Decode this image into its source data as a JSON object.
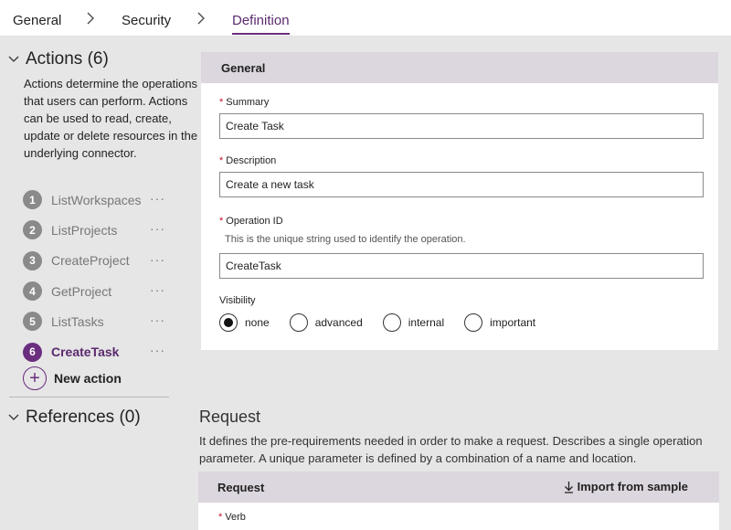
{
  "breadcrumb": [
    {
      "label": "General"
    },
    {
      "label": "Security"
    },
    {
      "label": "Definition"
    }
  ],
  "sidebar": {
    "actions_title": "Actions (6)",
    "actions_description": "Actions determine the operations that users can perform. Actions can be used to read, create, update or delete resources in the underlying connector.",
    "actions": [
      {
        "number": "1",
        "label": "ListWorkspaces",
        "more": "···"
      },
      {
        "number": "2",
        "label": "ListProjects",
        "more": "···"
      },
      {
        "number": "3",
        "label": "CreateProject",
        "more": "···"
      },
      {
        "number": "4",
        "label": "GetProject",
        "more": "···"
      },
      {
        "number": "5",
        "label": "ListTasks",
        "more": "···"
      },
      {
        "number": "6",
        "label": "CreateTask",
        "more": "···",
        "active": true
      }
    ],
    "new_action_label": "New action",
    "references_title": "References (0)"
  },
  "general": {
    "header": "General",
    "summary_label": "Summary",
    "summary_value": "Create Task",
    "description_label": "Description",
    "description_value": "Create a new task",
    "operation_id_label": "Operation ID",
    "operation_id_hint": "This is the unique string used to identify the operation.",
    "operation_id_value": "CreateTask",
    "visibility_label": "Visibility",
    "visibility_options": [
      {
        "label": "none",
        "selected": true
      },
      {
        "label": "advanced",
        "selected": false
      },
      {
        "label": "internal",
        "selected": false
      },
      {
        "label": "important",
        "selected": false
      }
    ],
    "required_marker": "*"
  },
  "request": {
    "title": "Request",
    "description": "It defines the pre-requirements needed in order to make a request. Describes a single operation parameter. A unique parameter is defined by a combination of a name and location.",
    "header": "Request",
    "import_label": "Import from sample",
    "verb_label": "Verb"
  },
  "colors": {
    "accent": "#6b2d7e",
    "header_bg": "#dcd6de",
    "required": "#c0152a",
    "canvas": "#e6e6e6"
  }
}
